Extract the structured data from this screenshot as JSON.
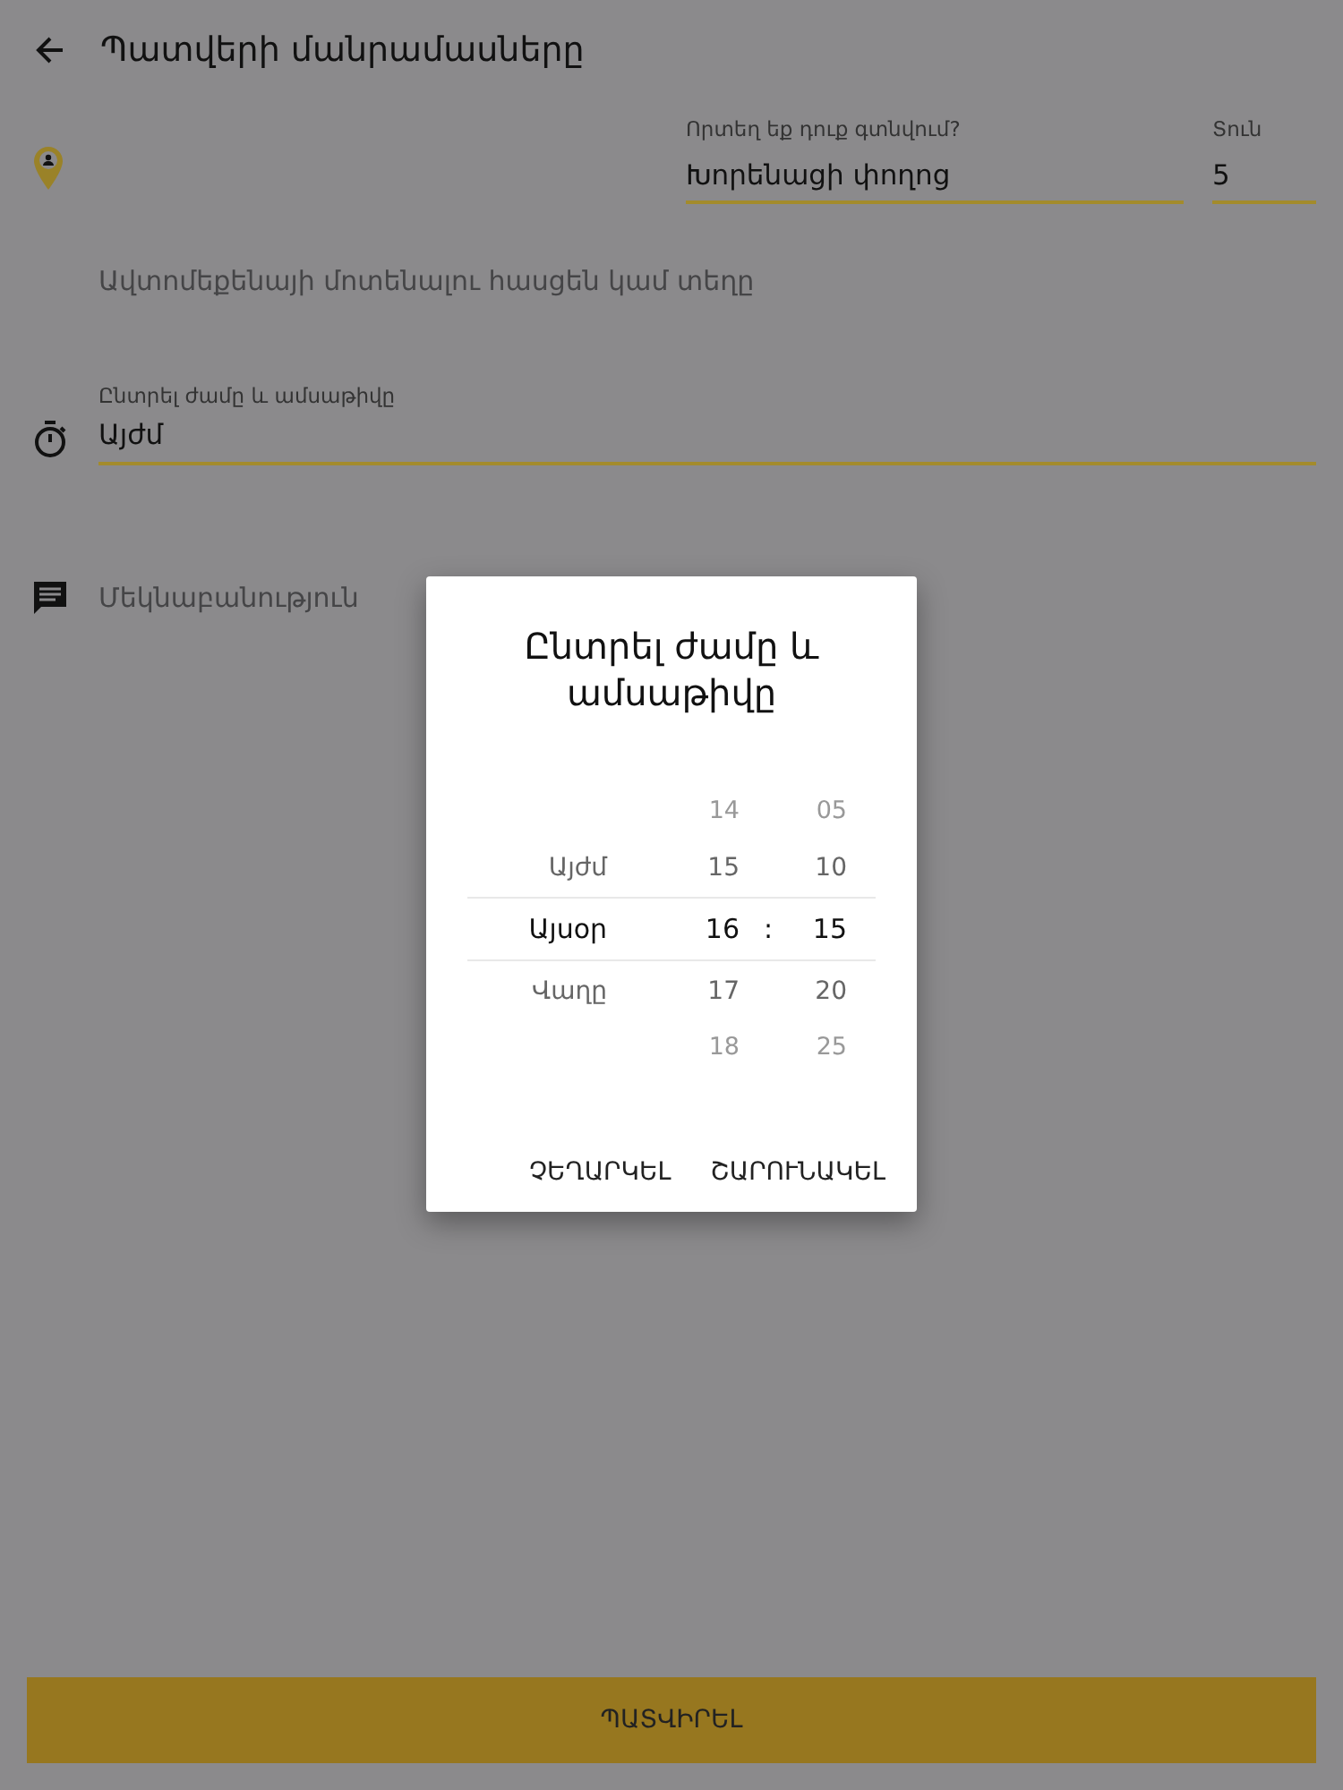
{
  "header": {
    "title": "Պատվերի մանրամասները"
  },
  "location": {
    "label": "Որտեղ եք դուք գտնվում?",
    "value": "Խորենացի փողոց",
    "house_label": "Տուն",
    "house_value": "5"
  },
  "pickup": {
    "placeholder": "Ավտոմեքենայի մոտենալու հասցեն կամ տեղը"
  },
  "time": {
    "label": "Ընտրել ժամը և ամսաթիվը",
    "value": "Այժմ"
  },
  "comment": {
    "placeholder": "Մեկնաբանություն"
  },
  "dialog": {
    "title": "Ընտրել ժամը և ամսաթիվը",
    "separator": ":",
    "rows": [
      {
        "day": "",
        "hour": "14",
        "minute": "05",
        "selected": false
      },
      {
        "day": "Այժմ",
        "hour": "15",
        "minute": "10",
        "selected": false
      },
      {
        "day": "Այսօր",
        "hour": "16",
        "minute": "15",
        "selected": true
      },
      {
        "day": "Վաղը",
        "hour": "17",
        "minute": "20",
        "selected": false
      },
      {
        "day": "",
        "hour": "18",
        "minute": "25",
        "selected": false
      }
    ],
    "buttons": [
      "ՉԵՂԱՐԿԵԼ",
      "ՇԱՐՈՒՆԱԿԵԼ"
    ]
  },
  "confirm_button": "ՊԱՏՎԻՐԵԼ"
}
